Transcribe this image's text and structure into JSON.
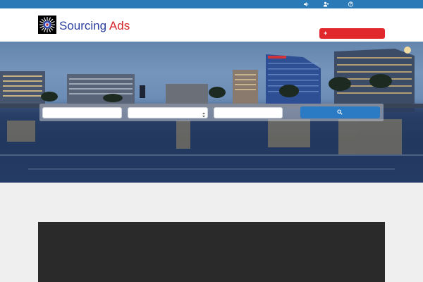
{
  "topbar": {
    "icons": [
      "speaker-icon",
      "user-plus-icon",
      "help-circle-icon"
    ]
  },
  "header": {
    "brand_word1": "Sourcing",
    "brand_word2": "Ads",
    "add_button_plus": "+",
    "add_button_label": ""
  },
  "search": {
    "keyword_placeholder": "",
    "category_value": "",
    "location_placeholder": "",
    "button_icon": "search-icon"
  },
  "colors": {
    "topbar": "#2a7ab8",
    "brand_primary": "#2a3f9e",
    "brand_accent": "#d3242a",
    "search_button": "#2a7ac4"
  }
}
